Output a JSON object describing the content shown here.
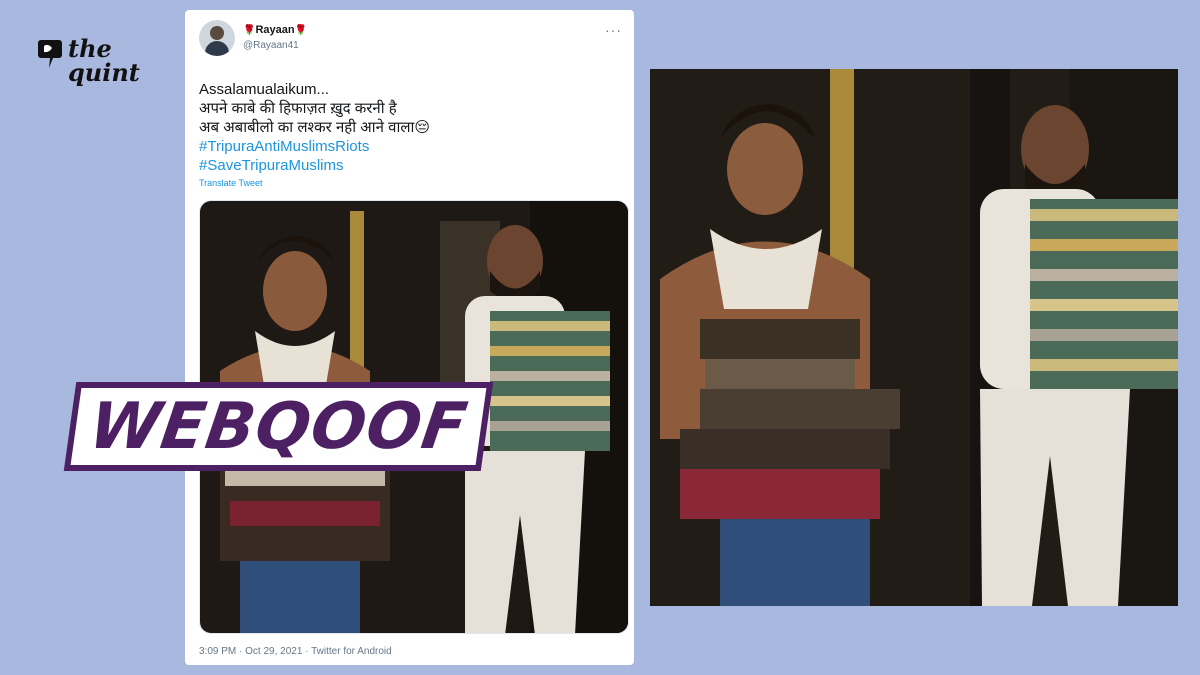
{
  "logo": {
    "line1": "the",
    "line2": "quint"
  },
  "tweet": {
    "display_name": "Rayaan",
    "rose": "🌹",
    "handle": "@Rayaan41",
    "more": "···",
    "lines": [
      "Assalamualaikum...",
      "अपने काबे की हिफाज़त ख़ुद करनी है",
      "अब अबाबीलो का लश्कर नही आने वाला😔"
    ],
    "hashtags": [
      "#TripuraAntiMuslimsRiots",
      "#SaveTripuraMuslims"
    ],
    "translate": "Translate Tweet",
    "meta": "3:09 PM · Oct 29, 2021 · Twitter for Android"
  },
  "banner": {
    "text": "WEBQOOF"
  },
  "colors": {
    "background": "#a9b8df",
    "banner": "#4d1f63",
    "link": "#1b95e0"
  }
}
